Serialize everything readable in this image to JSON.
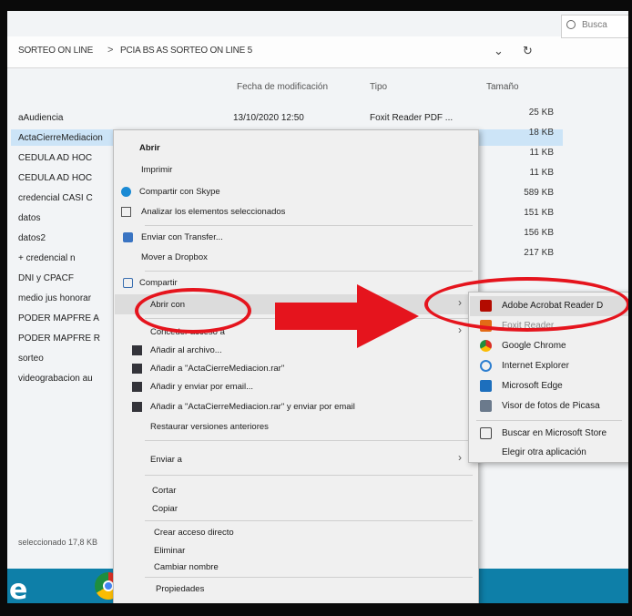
{
  "address": {
    "crumbs": [
      "SORTEO ON LINE",
      "PCIA BS AS SORTEO ON LINE 5"
    ],
    "separator": ">",
    "dropdown_glyph": "⌄",
    "refresh_glyph": "↻",
    "search_placeholder": "Busca"
  },
  "columns": {
    "modified": "Fecha de modificación",
    "type": "Tipo",
    "size": "Tamaño"
  },
  "files": [
    {
      "name": "aAudiencia",
      "date": "13/10/2020 12:50",
      "type": "Foxit Reader PDF ...",
      "size": "25 KB"
    },
    {
      "name": "ActaCierreMediacion",
      "size": "18 KB"
    },
    {
      "name": "CEDULA AD HOC",
      "size": "11 KB"
    },
    {
      "name": "CEDULA AD HOC",
      "size": "11 KB"
    },
    {
      "name": "credencial CASI C",
      "size": "589 KB"
    },
    {
      "name": "datos",
      "size": "151 KB"
    },
    {
      "name": "datos2",
      "size": "156 KB"
    },
    {
      "name": "+ credencial n",
      "size": "217 KB"
    },
    {
      "name": "DNI y CPACF",
      "size": ""
    },
    {
      "name": "medio jus honorar",
      "size": ""
    },
    {
      "name": "PODER MAPFRE A",
      "size": ""
    },
    {
      "name": "PODER MAPFRE R",
      "size": ""
    },
    {
      "name": "sorteo",
      "size": ""
    },
    {
      "name": "videograbacion au",
      "size": ""
    }
  ],
  "status": "seleccionado 17,8 KB",
  "context_menu": {
    "open": "Abrir",
    "print": "Imprimir",
    "share_skype": "Compartir con Skype",
    "analyze": "Analizar los elementos seleccionados",
    "transfer": "Enviar con Transfer...",
    "dropbox": "Mover a Dropbox",
    "share": "Compartir",
    "open_with": "Abrir con",
    "grant_access": "Conceder acceso a",
    "add_archive": "Añadir al archivo...",
    "add_rar": "Añadir a \"ActaCierreMediacion.rar\"",
    "add_email": "Añadir y enviar por email...",
    "add_rar_email": "Añadir a \"ActaCierreMediacion.rar\" y enviar por email",
    "restore": "Restaurar versiones anteriores",
    "send_to": "Enviar a",
    "cut": "Cortar",
    "copy": "Copiar",
    "shortcut": "Crear acceso directo",
    "delete": "Eliminar",
    "rename": "Cambiar nombre",
    "properties": "Propiedades"
  },
  "submenu": {
    "items": [
      "Adobe Acrobat Reader D",
      "Foxit Reader",
      "Google Chrome",
      "Internet Explorer",
      "Microsoft Edge",
      "Visor de fotos de Picasa"
    ],
    "store": "Buscar en Microsoft Store",
    "choose": "Elegir otra aplicación"
  },
  "taskbar": {
    "edge_glyph": "e"
  },
  "colors": {
    "annotation": "#e5141d",
    "taskbar": "#0e7fa8",
    "selection": "#cce4f7"
  }
}
